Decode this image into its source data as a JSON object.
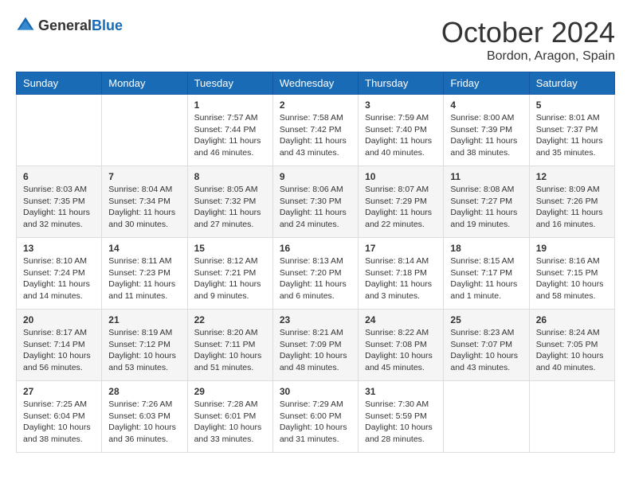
{
  "header": {
    "logo_general": "General",
    "logo_blue": "Blue",
    "month_title": "October 2024",
    "location": "Bordon, Aragon, Spain"
  },
  "weekdays": [
    "Sunday",
    "Monday",
    "Tuesday",
    "Wednesday",
    "Thursday",
    "Friday",
    "Saturday"
  ],
  "weeks": [
    [
      {
        "day": "",
        "sunrise": "",
        "sunset": "",
        "daylight": ""
      },
      {
        "day": "",
        "sunrise": "",
        "sunset": "",
        "daylight": ""
      },
      {
        "day": "1",
        "sunrise": "Sunrise: 7:57 AM",
        "sunset": "Sunset: 7:44 PM",
        "daylight": "Daylight: 11 hours and 46 minutes."
      },
      {
        "day": "2",
        "sunrise": "Sunrise: 7:58 AM",
        "sunset": "Sunset: 7:42 PM",
        "daylight": "Daylight: 11 hours and 43 minutes."
      },
      {
        "day": "3",
        "sunrise": "Sunrise: 7:59 AM",
        "sunset": "Sunset: 7:40 PM",
        "daylight": "Daylight: 11 hours and 40 minutes."
      },
      {
        "day": "4",
        "sunrise": "Sunrise: 8:00 AM",
        "sunset": "Sunset: 7:39 PM",
        "daylight": "Daylight: 11 hours and 38 minutes."
      },
      {
        "day": "5",
        "sunrise": "Sunrise: 8:01 AM",
        "sunset": "Sunset: 7:37 PM",
        "daylight": "Daylight: 11 hours and 35 minutes."
      }
    ],
    [
      {
        "day": "6",
        "sunrise": "Sunrise: 8:03 AM",
        "sunset": "Sunset: 7:35 PM",
        "daylight": "Daylight: 11 hours and 32 minutes."
      },
      {
        "day": "7",
        "sunrise": "Sunrise: 8:04 AM",
        "sunset": "Sunset: 7:34 PM",
        "daylight": "Daylight: 11 hours and 30 minutes."
      },
      {
        "day": "8",
        "sunrise": "Sunrise: 8:05 AM",
        "sunset": "Sunset: 7:32 PM",
        "daylight": "Daylight: 11 hours and 27 minutes."
      },
      {
        "day": "9",
        "sunrise": "Sunrise: 8:06 AM",
        "sunset": "Sunset: 7:30 PM",
        "daylight": "Daylight: 11 hours and 24 minutes."
      },
      {
        "day": "10",
        "sunrise": "Sunrise: 8:07 AM",
        "sunset": "Sunset: 7:29 PM",
        "daylight": "Daylight: 11 hours and 22 minutes."
      },
      {
        "day": "11",
        "sunrise": "Sunrise: 8:08 AM",
        "sunset": "Sunset: 7:27 PM",
        "daylight": "Daylight: 11 hours and 19 minutes."
      },
      {
        "day": "12",
        "sunrise": "Sunrise: 8:09 AM",
        "sunset": "Sunset: 7:26 PM",
        "daylight": "Daylight: 11 hours and 16 minutes."
      }
    ],
    [
      {
        "day": "13",
        "sunrise": "Sunrise: 8:10 AM",
        "sunset": "Sunset: 7:24 PM",
        "daylight": "Daylight: 11 hours and 14 minutes."
      },
      {
        "day": "14",
        "sunrise": "Sunrise: 8:11 AM",
        "sunset": "Sunset: 7:23 PM",
        "daylight": "Daylight: 11 hours and 11 minutes."
      },
      {
        "day": "15",
        "sunrise": "Sunrise: 8:12 AM",
        "sunset": "Sunset: 7:21 PM",
        "daylight": "Daylight: 11 hours and 9 minutes."
      },
      {
        "day": "16",
        "sunrise": "Sunrise: 8:13 AM",
        "sunset": "Sunset: 7:20 PM",
        "daylight": "Daylight: 11 hours and 6 minutes."
      },
      {
        "day": "17",
        "sunrise": "Sunrise: 8:14 AM",
        "sunset": "Sunset: 7:18 PM",
        "daylight": "Daylight: 11 hours and 3 minutes."
      },
      {
        "day": "18",
        "sunrise": "Sunrise: 8:15 AM",
        "sunset": "Sunset: 7:17 PM",
        "daylight": "Daylight: 11 hours and 1 minute."
      },
      {
        "day": "19",
        "sunrise": "Sunrise: 8:16 AM",
        "sunset": "Sunset: 7:15 PM",
        "daylight": "Daylight: 10 hours and 58 minutes."
      }
    ],
    [
      {
        "day": "20",
        "sunrise": "Sunrise: 8:17 AM",
        "sunset": "Sunset: 7:14 PM",
        "daylight": "Daylight: 10 hours and 56 minutes."
      },
      {
        "day": "21",
        "sunrise": "Sunrise: 8:19 AM",
        "sunset": "Sunset: 7:12 PM",
        "daylight": "Daylight: 10 hours and 53 minutes."
      },
      {
        "day": "22",
        "sunrise": "Sunrise: 8:20 AM",
        "sunset": "Sunset: 7:11 PM",
        "daylight": "Daylight: 10 hours and 51 minutes."
      },
      {
        "day": "23",
        "sunrise": "Sunrise: 8:21 AM",
        "sunset": "Sunset: 7:09 PM",
        "daylight": "Daylight: 10 hours and 48 minutes."
      },
      {
        "day": "24",
        "sunrise": "Sunrise: 8:22 AM",
        "sunset": "Sunset: 7:08 PM",
        "daylight": "Daylight: 10 hours and 45 minutes."
      },
      {
        "day": "25",
        "sunrise": "Sunrise: 8:23 AM",
        "sunset": "Sunset: 7:07 PM",
        "daylight": "Daylight: 10 hours and 43 minutes."
      },
      {
        "day": "26",
        "sunrise": "Sunrise: 8:24 AM",
        "sunset": "Sunset: 7:05 PM",
        "daylight": "Daylight: 10 hours and 40 minutes."
      }
    ],
    [
      {
        "day": "27",
        "sunrise": "Sunrise: 7:25 AM",
        "sunset": "Sunset: 6:04 PM",
        "daylight": "Daylight: 10 hours and 38 minutes."
      },
      {
        "day": "28",
        "sunrise": "Sunrise: 7:26 AM",
        "sunset": "Sunset: 6:03 PM",
        "daylight": "Daylight: 10 hours and 36 minutes."
      },
      {
        "day": "29",
        "sunrise": "Sunrise: 7:28 AM",
        "sunset": "Sunset: 6:01 PM",
        "daylight": "Daylight: 10 hours and 33 minutes."
      },
      {
        "day": "30",
        "sunrise": "Sunrise: 7:29 AM",
        "sunset": "Sunset: 6:00 PM",
        "daylight": "Daylight: 10 hours and 31 minutes."
      },
      {
        "day": "31",
        "sunrise": "Sunrise: 7:30 AM",
        "sunset": "Sunset: 5:59 PM",
        "daylight": "Daylight: 10 hours and 28 minutes."
      },
      {
        "day": "",
        "sunrise": "",
        "sunset": "",
        "daylight": ""
      },
      {
        "day": "",
        "sunrise": "",
        "sunset": "",
        "daylight": ""
      }
    ]
  ]
}
